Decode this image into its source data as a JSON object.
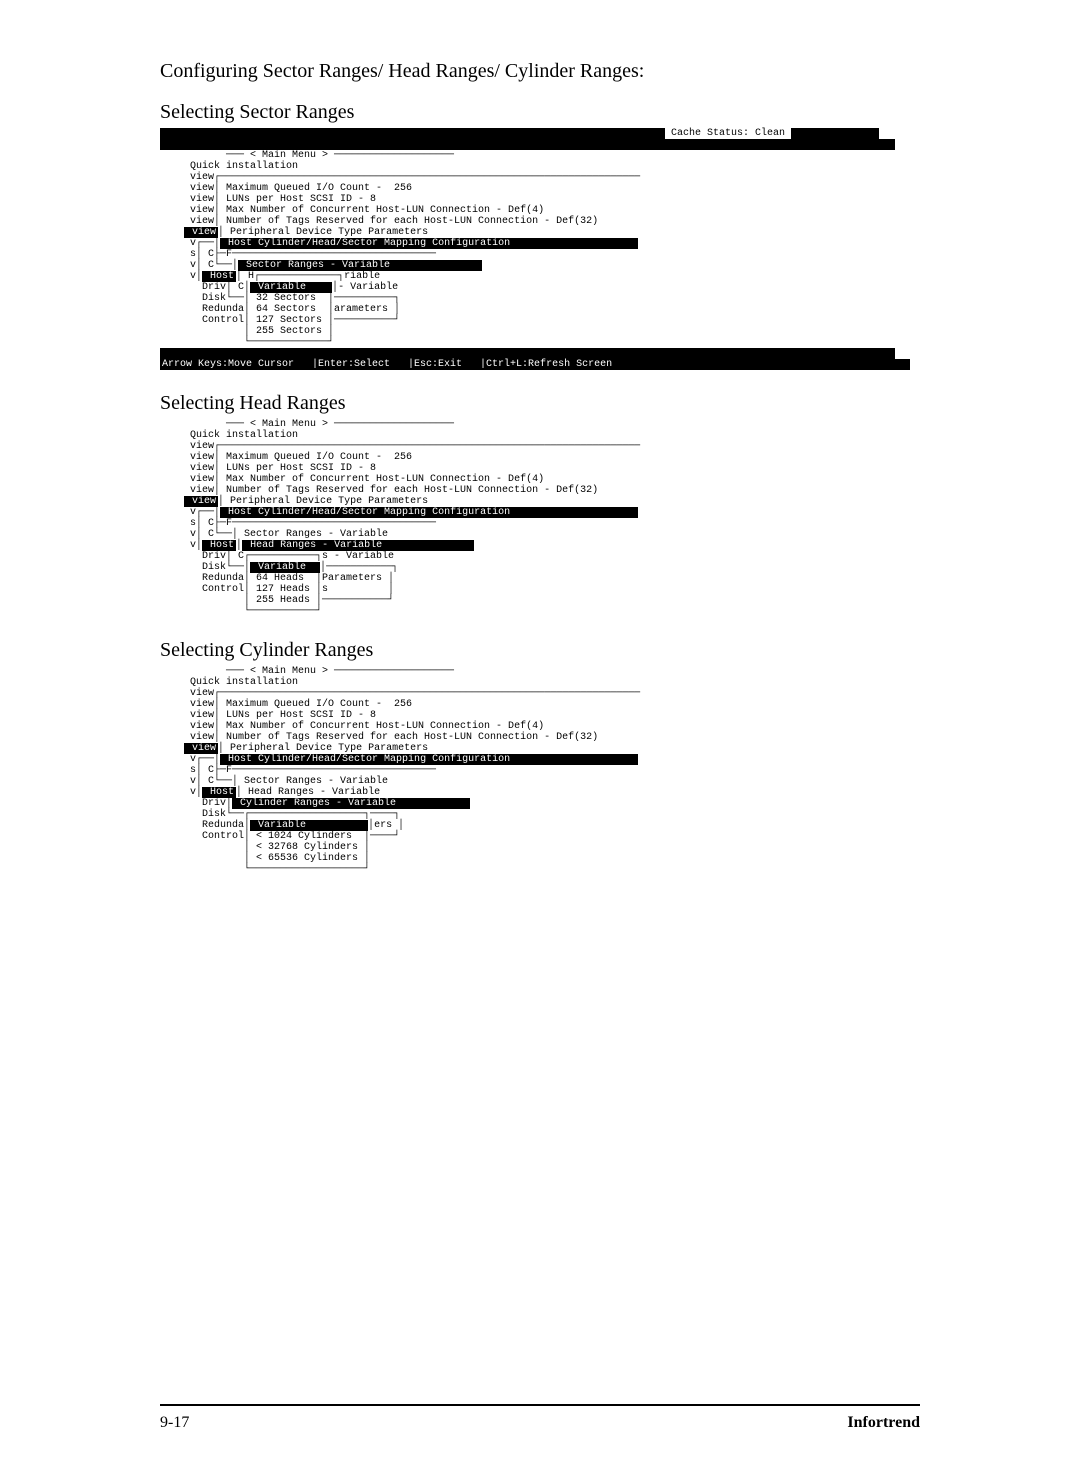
{
  "page": {
    "title": "Configuring Sector Ranges/ Head Ranges/ Cylinder Ranges:",
    "subheading_sector": "Selecting Sector Ranges",
    "subheading_head": "Selecting Head Ranges",
    "subheading_cyl": "Selecting Cylinder Ranges",
    "footer_left": "9-17",
    "footer_right": "Infortrend"
  },
  "common": {
    "cache_status": "Cache Status: Clean",
    "main_menu_label": "< Main Menu >",
    "quick_install": "Quick installation",
    "side_items": [
      "view",
      "view",
      "view",
      "view",
      "view",
      "view",
      "v",
      "s",
      "v",
      "v"
    ],
    "side_single": [
      "C",
      "C",
      "F"
    ],
    "params": {
      "max_queued": "Maximum Queued I/O Count -  256",
      "luns": "LUNs per Host SCSI ID - 8",
      "max_conn": "Max Number of Concurrent Host-LUN Connection - Def(4)",
      "tags": "Number of Tags Reserved for each Host-LUN Connection - Def(32)",
      "periph": "Peripheral Device Type Parameters",
      "hostmap": "Host Cylinder/Head/Sector Mapping Configuration"
    },
    "lower_left": [
      "Host",
      "Driv",
      "Disk",
      "Redunda",
      "Control"
    ],
    "status_line": "Arrow Keys:Move Cursor   |Enter:Select   |Esc:Exit   |Ctrl+L:Refresh Screen"
  },
  "sector": {
    "sel_line": "Sector Ranges - Variable",
    "frag_riable": "riable",
    "frag_var": "- Variable",
    "col_h": "H",
    "col_c": "C",
    "options": [
      "Variable",
      "32 Sectors",
      "64 Sectors",
      "127 Sectors",
      "255 Sectors"
    ],
    "right_word": "arameters"
  },
  "head": {
    "sector_line": "Sector Ranges - Variable",
    "head_line": "Head Ranges - Variable",
    "frag_s_var": "s - Variable",
    "col_c": "C",
    "options": [
      "Variable",
      "64 Heads",
      "127 Heads",
      "255 Heads"
    ],
    "right_word": "Parameters",
    "right_s": "s"
  },
  "cyl": {
    "sector_line": "Sector Ranges - Variable",
    "head_line": "Head Ranges - Variable",
    "cyl_line": "Cylinder Ranges - Variable",
    "options": [
      "Variable",
      "< 1024 Cylinders",
      "< 32768 Cylinders",
      "< 65536 Cylinders"
    ],
    "right_word": "ers"
  }
}
